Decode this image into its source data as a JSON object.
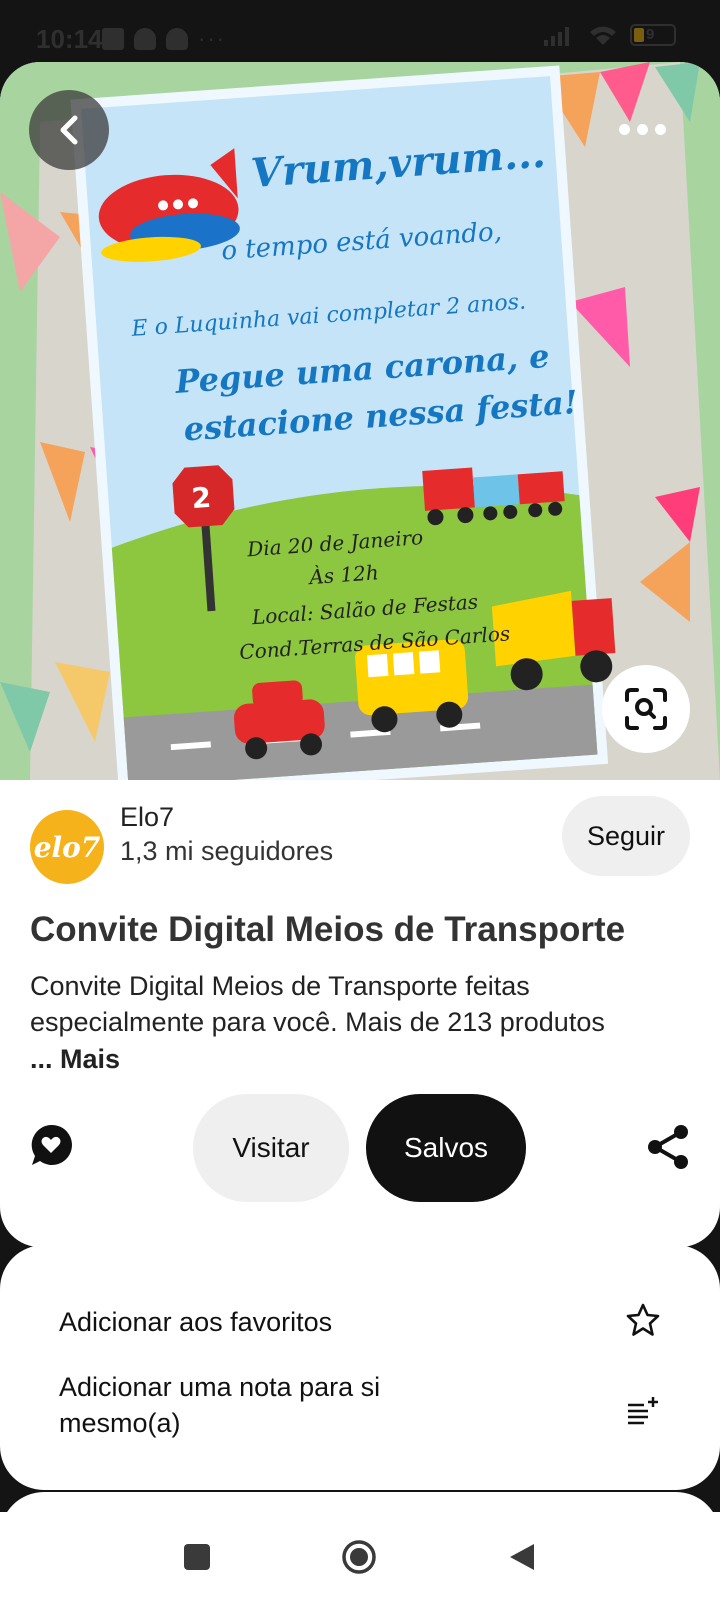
{
  "status_bar": {
    "time": "10:14",
    "battery": "9"
  },
  "pin": {
    "invite_lines": [
      "Vrum,vrum...",
      "o tempo está voando,",
      "E o Luquinha vai completar 2 anos.",
      "Pegue uma carona, e",
      "estacione nessa festa!",
      "Dia 20 de Janeiro",
      "Às 12h",
      "Local: Salão de Festas",
      "Cond.Terras de São Carlos"
    ],
    "sign_number": "2"
  },
  "creator": {
    "avatar_text": "elo7",
    "name": "Elo7",
    "followers": "1,3 mi seguidores",
    "follow_label": "Seguir"
  },
  "title": "Convite Digital Meios de Transporte",
  "description": "Convite Digital Meios de Transporte feitas especialmente para você. Mais de 213 produtos",
  "more_label": "... Mais",
  "actions": {
    "visit_label": "Visitar",
    "saved_label": "Salvos"
  },
  "sheet": {
    "favorite_label": "Adicionar aos favoritos",
    "note_label": "Adicionar uma nota para si mesmo(a)"
  },
  "colors": {
    "accent_dark": "#111111",
    "avatar": "#f6b21b",
    "button_gray": "#efefef",
    "invite_text": "#1577c2"
  }
}
